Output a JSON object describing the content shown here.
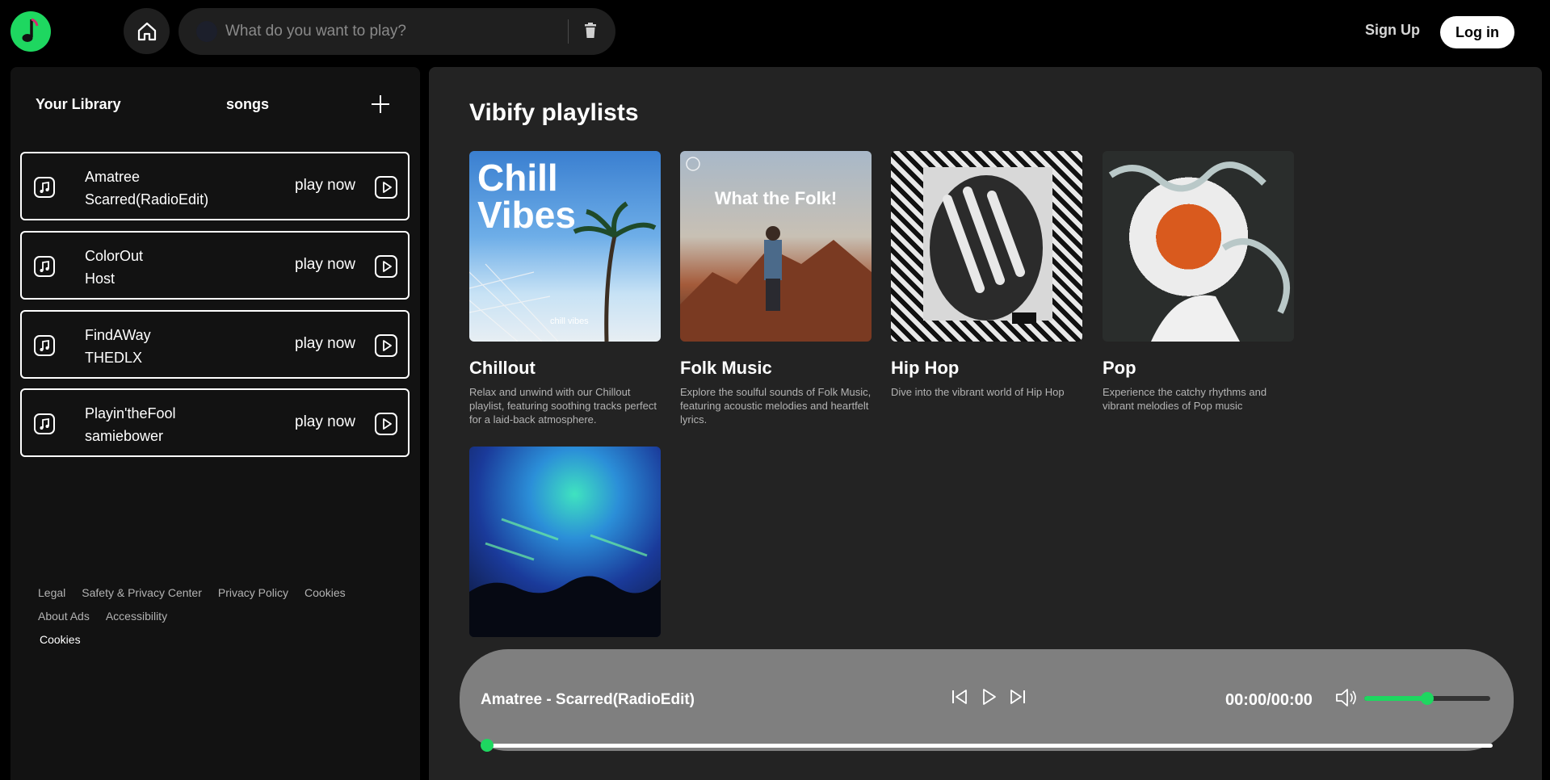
{
  "header": {
    "logo_icon": "music-note-icon",
    "home_icon": "home-icon",
    "search": {
      "placeholder": "What do you want to play?",
      "value": ""
    },
    "clear_icon": "trash-icon",
    "signup_label": "Sign Up",
    "login_label": "Log in",
    "accent": "#1ed760"
  },
  "sidebar": {
    "title": "Your Library",
    "songs_label": "songs",
    "add_icon": "plus-icon",
    "songs": [
      {
        "title": "Amatree",
        "artist": "Scarred(RadioEdit)",
        "action": "play now"
      },
      {
        "title": "ColorOut",
        "artist": "Host",
        "action": "play now"
      },
      {
        "title": "FindAWay",
        "artist": "THEDLX",
        "action": "play now"
      },
      {
        "title": "Playin'theFool",
        "artist": "samiebower",
        "action": "play now"
      }
    ],
    "footer": {
      "row1": [
        "Legal",
        "Safety & Privacy Center",
        "Privacy Policy",
        "Cookies"
      ],
      "row2": [
        "About Ads",
        "Accessibility"
      ],
      "cookies": "Cookies"
    }
  },
  "main": {
    "title": "Vibify playlists",
    "playlists": [
      {
        "name": "Chillout",
        "description": "Relax and unwind with our Chillout playlist, featuring soothing tracks perfect for a laid-back atmosphere.",
        "cover_text": "Chill Vibes",
        "cover_small": "chill vibes"
      },
      {
        "name": "Folk Music",
        "description": "Explore the soulful sounds of Folk Music, featuring acoustic melodies and heartfelt lyrics.",
        "cover_text": "What the Folk!"
      },
      {
        "name": "Hip Hop",
        "description": "Dive into the vibrant world of Hip Hop"
      },
      {
        "name": "Pop",
        "description": "Experience the catchy rhythms and vibrant melodies of Pop music"
      },
      {
        "name": "",
        "description": ""
      }
    ]
  },
  "player": {
    "now_playing": "Amatree - Scarred(RadioEdit)",
    "time": "00:00/00:00",
    "volume": 0.5,
    "progress": 0.0,
    "icons": [
      "skip-back-icon",
      "play-icon",
      "skip-forward-icon",
      "volume-icon"
    ]
  }
}
